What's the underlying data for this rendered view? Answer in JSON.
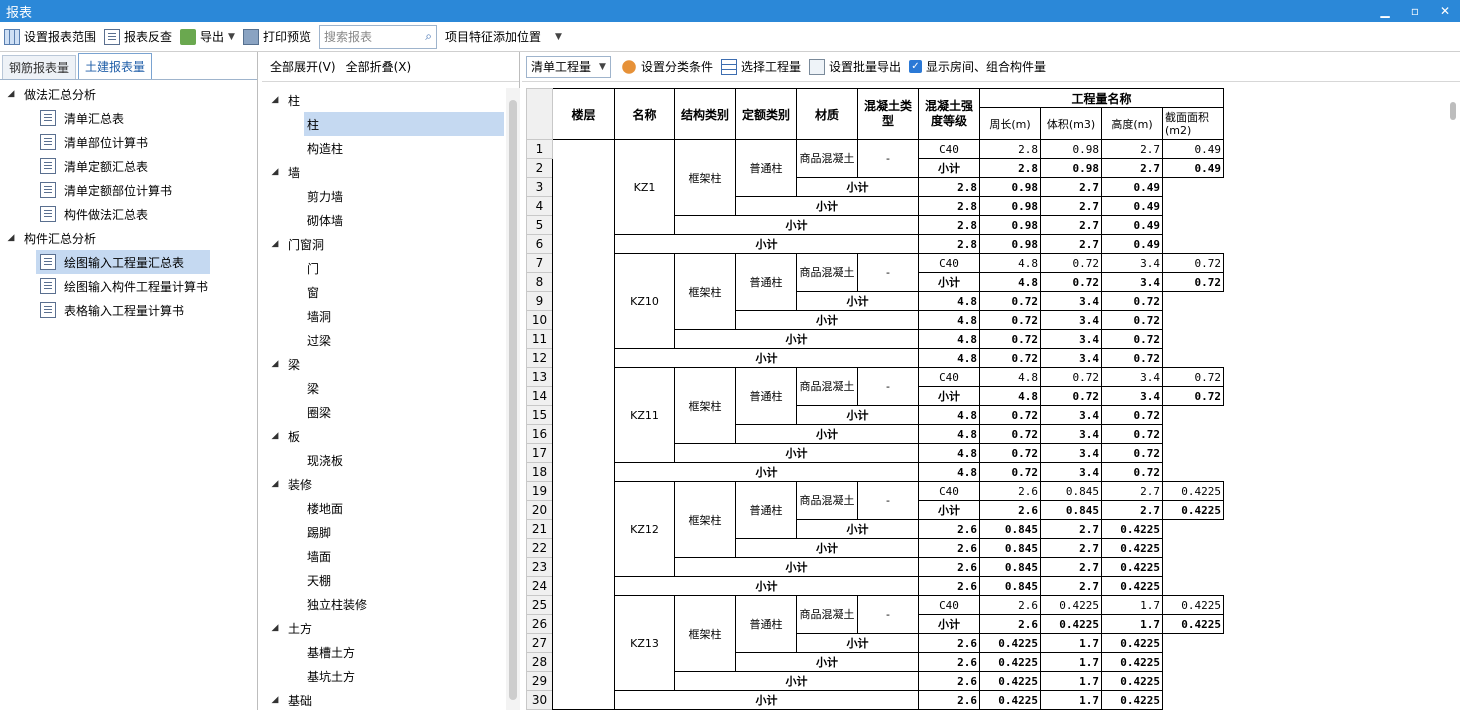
{
  "window": {
    "title": "报表",
    "minimize": "▁",
    "restore": "▫",
    "close": "✕"
  },
  "toolbar": {
    "set_range": "设置报表范围",
    "reverse_check": "报表反查",
    "export": "导出",
    "print_preview": "打印预览",
    "search_placeholder": "搜索报表",
    "feature_position": "项目特征添加位置"
  },
  "left": {
    "tabs": [
      "钢筋报表量",
      "土建报表量"
    ],
    "groups": [
      {
        "label": "做法汇总分析",
        "items": [
          "清单汇总表",
          "清单部位计算书",
          "清单定额汇总表",
          "清单定额部位计算书",
          "构件做法汇总表"
        ]
      },
      {
        "label": "构件汇总分析",
        "items": [
          "绘图输入工程量汇总表",
          "绘图输入构件工程量计算书",
          "表格输入工程量计算书"
        ]
      }
    ]
  },
  "middle": {
    "expand_all": "全部展开(V)",
    "collapse_all": "全部折叠(X)",
    "groups": [
      {
        "label": "柱",
        "items": [
          "柱",
          "构造柱"
        ]
      },
      {
        "label": "墙",
        "items": [
          "剪力墙",
          "砌体墙"
        ]
      },
      {
        "label": "门窗洞",
        "items": [
          "门",
          "窗",
          "墙洞",
          "过梁"
        ]
      },
      {
        "label": "梁",
        "items": [
          "梁",
          "圈梁"
        ]
      },
      {
        "label": "板",
        "items": [
          "现浇板"
        ]
      },
      {
        "label": "装修",
        "items": [
          "楼地面",
          "踢脚",
          "墙面",
          "天棚",
          "独立柱装修"
        ]
      },
      {
        "label": "土方",
        "items": [
          "基槽土方",
          "基坑土方"
        ]
      },
      {
        "label": "基础",
        "items": []
      }
    ]
  },
  "right": {
    "quantity_combo": "清单工程量",
    "set_category": "设置分类条件",
    "select_quantity": "选择工程量",
    "batch_export": "设置批量导出",
    "show_rooms_label": "显示房间、组合构件量",
    "show_rooms_checked": true
  },
  "table": {
    "headers": {
      "floor": "楼层",
      "name": "名称",
      "struct_type": "结构类别",
      "quota_type": "定额类别",
      "material": "材质",
      "concrete_type": "混凝土类型",
      "concrete_grade": "混凝土强度等级",
      "quantity_group": "工程量名称",
      "perimeter": "周长(m)",
      "volume": "体积(m3)",
      "height": "高度(m)",
      "section_area": "截面面积(m2)"
    },
    "subtotal": "小计",
    "groups": [
      {
        "name": "KZ1",
        "struct": "框架柱",
        "quota": "普通柱",
        "material": "商品混凝土",
        "ctype": "-",
        "grade": "C40",
        "vals": [
          "2.8",
          "0.98",
          "2.7",
          "0.49"
        ]
      },
      {
        "name": "KZ10",
        "struct": "框架柱",
        "quota": "普通柱",
        "material": "商品混凝土",
        "ctype": "-",
        "grade": "C40",
        "vals": [
          "4.8",
          "0.72",
          "3.4",
          "0.72"
        ]
      },
      {
        "name": "KZ11",
        "struct": "框架柱",
        "quota": "普通柱",
        "material": "商品混凝土",
        "ctype": "-",
        "grade": "C40",
        "vals": [
          "4.8",
          "0.72",
          "3.4",
          "0.72"
        ]
      },
      {
        "name": "KZ12",
        "struct": "框架柱",
        "quota": "普通柱",
        "material": "商品混凝土",
        "ctype": "-",
        "grade": "C40",
        "vals": [
          "2.6",
          "0.845",
          "2.7",
          "0.4225"
        ]
      },
      {
        "name": "KZ13",
        "struct": "框架柱",
        "quota": "普通柱",
        "material": "商品混凝土",
        "ctype": "-",
        "grade": "C40",
        "vals": [
          "2.6",
          "0.4225",
          "1.7",
          "0.4225"
        ]
      }
    ]
  }
}
